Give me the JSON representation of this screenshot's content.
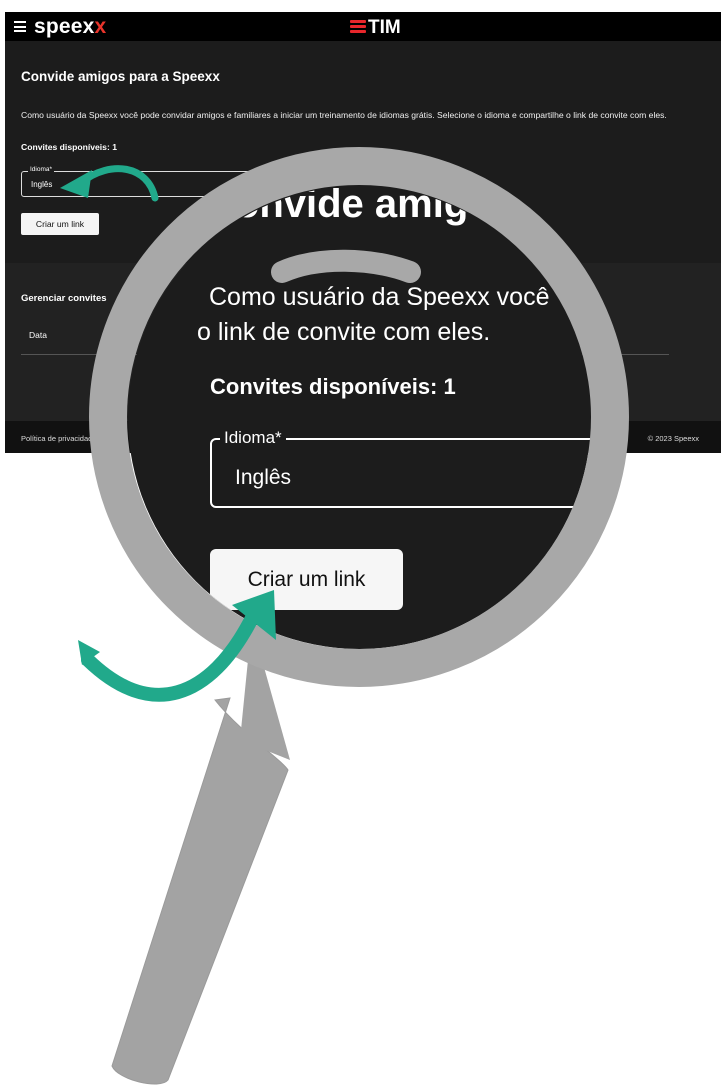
{
  "topbar": {
    "brand_main": "speex",
    "brand_accent": "x",
    "tim": "TIM"
  },
  "invite": {
    "title": "Convide amigos para a Speexx",
    "description": "Como usuário da Speexx você pode convidar amigos e familiares a iniciar um treinamento de idiomas grátis. Selecione o idioma e compartilhe o link de convite com eles.",
    "available": "Convites disponíveis: 1",
    "language_label": "Idioma*",
    "language_value": "Inglês",
    "create_button": "Criar um link"
  },
  "manage": {
    "title": "Gerenciar convites",
    "col_date": "Data"
  },
  "footer": {
    "policy": "Política de privacidade",
    "copyright": "© 2023 Speexx"
  },
  "zoom": {
    "title": "Convide amigos",
    "line1": "Como usuário da Speexx você",
    "line2": "o link de convite com eles.",
    "available": "Convites disponíveis: 1",
    "language_label": "Idioma*",
    "language_value": "Inglês",
    "create_button": "Criar um link"
  },
  "colors": {
    "accent_red": "#e8342b",
    "arrow_teal": "#21a98b",
    "lens_gray": "#a8a8a8",
    "dark_bg": "#1c1c1c"
  },
  "icons": [
    "menu-icon",
    "tim-logo-icon",
    "magnifier-icon",
    "arrow-icon"
  ]
}
